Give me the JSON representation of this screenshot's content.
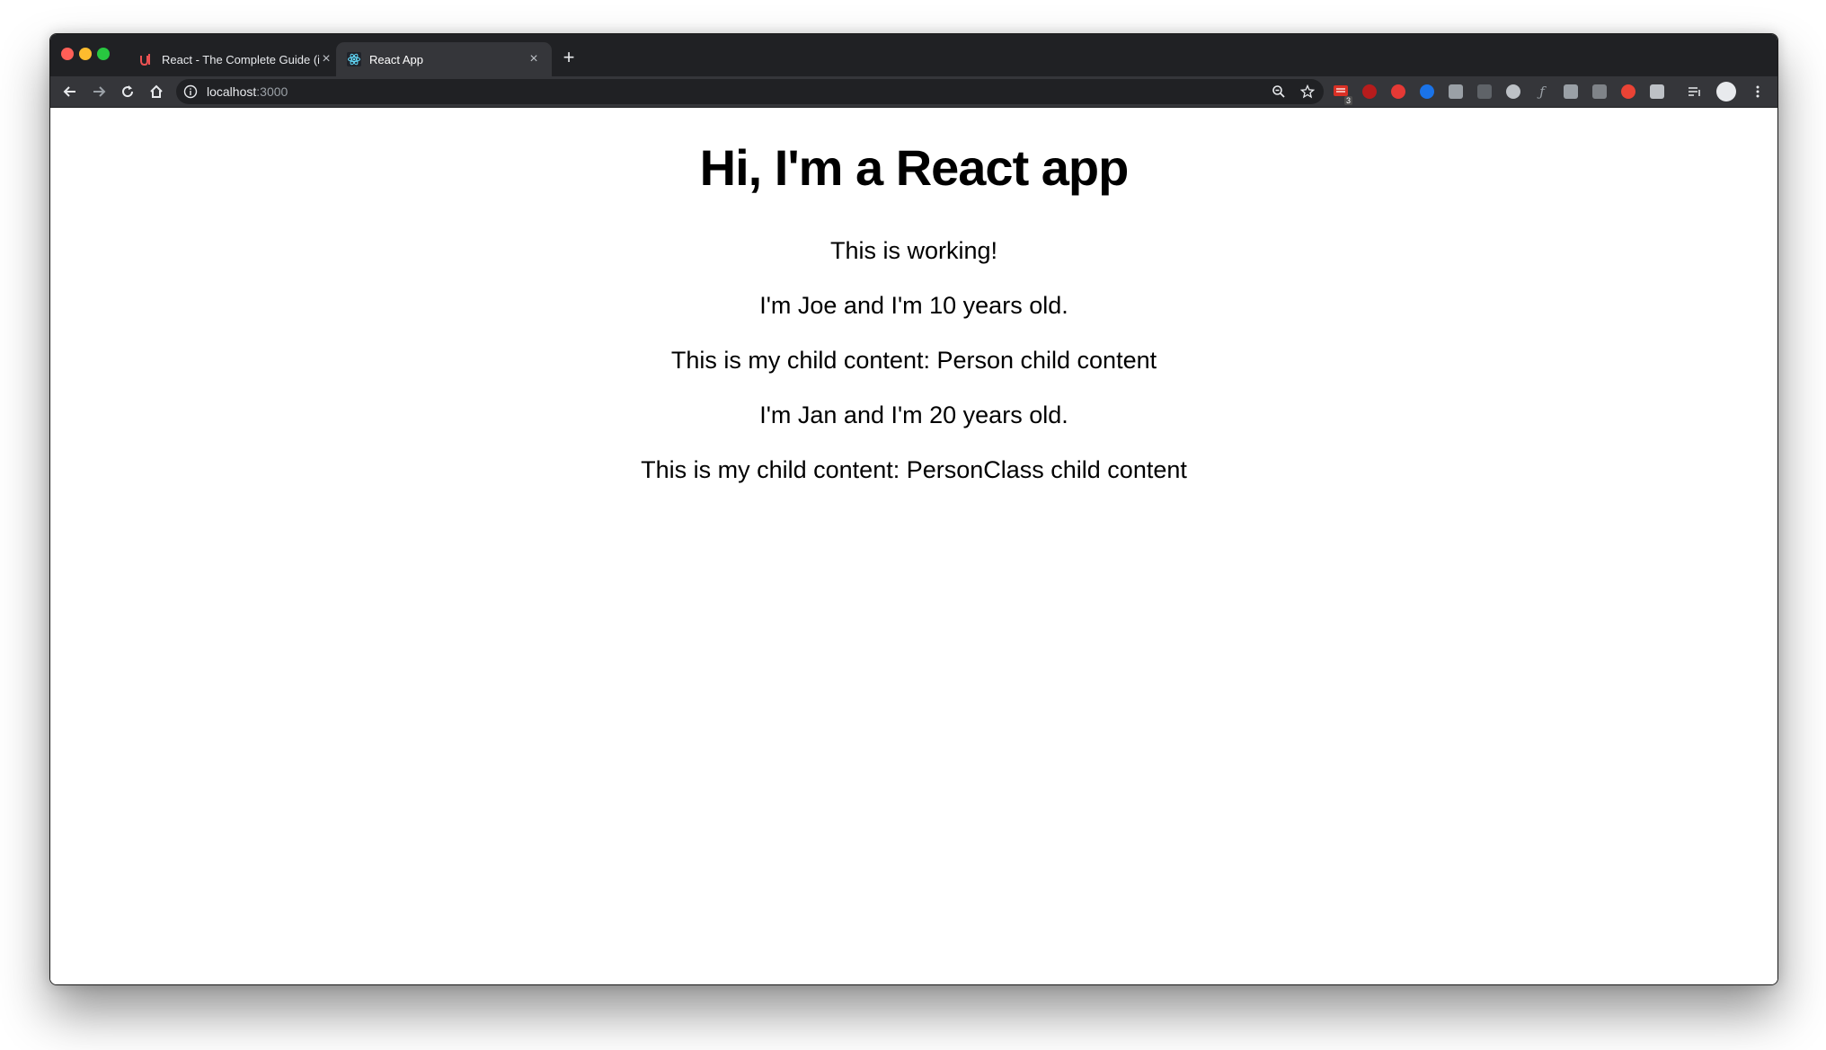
{
  "browser": {
    "tabs": [
      {
        "title": "React - The Complete Guide (i",
        "favicon": "udemy-icon"
      },
      {
        "title": "React App",
        "favicon": "react-icon"
      }
    ],
    "new_tab_label": "+",
    "address": {
      "host": "localhost",
      "port": ":3000"
    }
  },
  "page": {
    "heading": "Hi, I'm a React app",
    "lines": [
      "This is working!",
      "I'm Joe and I'm 10 years old.",
      "This is my child content: Person child content",
      "I'm Jan and I'm 20 years old.",
      "This is my child content: PersonClass child content"
    ]
  },
  "extensions": {
    "badge_count": "3",
    "colors": [
      "#d93025",
      "#b71c1c",
      "#e53935",
      "#1a73e8",
      "#9aa0a6",
      "#5f6368",
      "#bdc1c6",
      "#9aa0a6",
      "#9aa0a6",
      "#7f8388",
      "#ea4335",
      "#bdc1c6"
    ]
  }
}
